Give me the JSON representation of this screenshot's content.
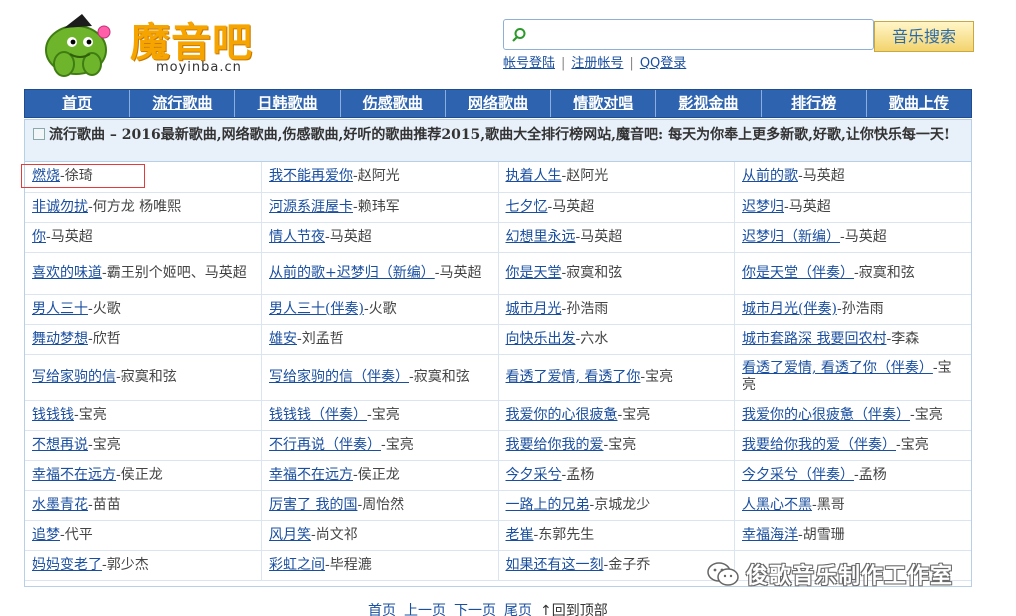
{
  "header": {
    "logo_text": "魔音吧",
    "logo_domain": "moyinba.cn",
    "search_button": "音乐搜索",
    "search_value": "",
    "account": {
      "login": "帐号登陆",
      "register": "注册帐号",
      "qq": "QQ登录"
    }
  },
  "nav": [
    "首页",
    "流行歌曲",
    "日韩歌曲",
    "伤感歌曲",
    "网络歌曲",
    "情歌对唱",
    "影视金曲",
    "排行榜",
    "歌曲上传"
  ],
  "intro": {
    "title": "流行歌曲",
    "text": " – 2016最新歌曲,网络歌曲,伤感歌曲,好听的歌曲推荐2015,歌曲大全排行榜网站,魔音吧: 每天为你奉上更多新歌,好歌,让你快乐每一天!"
  },
  "rows": [
    [
      {
        "song": "燃烧",
        "artist": "徐琦"
      },
      {
        "song": "我不能再爱你",
        "artist": "赵阿光"
      },
      {
        "song": "执着人生",
        "artist": "赵阿光"
      },
      {
        "song": "从前的歌",
        "artist": "马英超"
      }
    ],
    [
      {
        "song": "非诚勿扰",
        "artist": "何方龙 杨唯熙"
      },
      {
        "song": "河源系涯屋卡",
        "artist": "赖玮军"
      },
      {
        "song": "七夕忆",
        "artist": "马英超"
      },
      {
        "song": "迟梦归",
        "artist": "马英超"
      }
    ],
    [
      {
        "song": "你",
        "artist": "马英超"
      },
      {
        "song": "情人节夜",
        "artist": "马英超"
      },
      {
        "song": "幻想里永远",
        "artist": "马英超"
      },
      {
        "song": "迟梦归（新编）",
        "artist": "马英超"
      }
    ],
    [
      {
        "song": "喜欢的味道",
        "artist": "霸王别个姬吧、马英超"
      },
      {
        "song": "从前的歌+迟梦归（新编）",
        "artist": "马英超"
      },
      {
        "song": "你是天堂",
        "artist": "寂寞和弦"
      },
      {
        "song": "你是天堂（伴奏）",
        "artist": "寂寞和弦"
      }
    ],
    [
      {
        "song": "男人三十",
        "artist": "火歌"
      },
      {
        "song": "男人三十(伴奏)",
        "artist": "火歌"
      },
      {
        "song": "城市月光",
        "artist": "孙浩雨"
      },
      {
        "song": "城市月光(伴奏)",
        "artist": "孙浩雨"
      }
    ],
    [
      {
        "song": "舞动梦想",
        "artist": "欣哲"
      },
      {
        "song": "雄安",
        "artist": "刘孟哲"
      },
      {
        "song": "向快乐出发",
        "artist": "六水"
      },
      {
        "song": "城市套路深 我要回农村",
        "artist": "李森"
      }
    ],
    [
      {
        "song": "写给家驹的信",
        "artist": "寂寞和弦"
      },
      {
        "song": "写给家驹的信（伴奏）",
        "artist": "寂寞和弦"
      },
      {
        "song": "看透了爱情, 看透了你",
        "artist": "宝亮"
      },
      {
        "song": "看透了爱情, 看透了你（伴奏）",
        "artist": "宝亮"
      }
    ],
    [
      {
        "song": "钱钱钱",
        "artist": "宝亮"
      },
      {
        "song": "钱钱钱（伴奏）",
        "artist": "宝亮"
      },
      {
        "song": "我爱你的心很疲惫",
        "artist": "宝亮"
      },
      {
        "song": "我爱你的心很疲惫（伴奏）",
        "artist": "宝亮"
      }
    ],
    [
      {
        "song": "不想再说",
        "artist": "宝亮"
      },
      {
        "song": "不行再说（伴奏）",
        "artist": "宝亮"
      },
      {
        "song": "我要给你我的爱",
        "artist": "宝亮"
      },
      {
        "song": "我要给你我的爱（伴奏）",
        "artist": "宝亮"
      }
    ],
    [
      {
        "song": "幸福不在远方",
        "artist": "侯正龙"
      },
      {
        "song": "幸福不在远方",
        "artist": "侯正龙"
      },
      {
        "song": "今夕采兮",
        "artist": "孟杨"
      },
      {
        "song": "今夕采兮（伴奏）",
        "artist": "孟杨"
      }
    ],
    [
      {
        "song": "水墨青花",
        "artist": "苗苗"
      },
      {
        "song": "厉害了 我的国",
        "artist": "周怡然"
      },
      {
        "song": "一路上的兄弟",
        "artist": "京城龙少"
      },
      {
        "song": "人黑心不黑",
        "artist": "黑哥"
      }
    ],
    [
      {
        "song": "追梦",
        "artist": "代平"
      },
      {
        "song": "风月笑",
        "artist": "尚文祁"
      },
      {
        "song": "老崔",
        "artist": "东郭先生"
      },
      {
        "song": "幸福海洋",
        "artist": "胡雪珊"
      }
    ],
    [
      {
        "song": "妈妈变老了",
        "artist": "郭少杰"
      },
      {
        "song": "彩虹之间",
        "artist": "毕程漉"
      },
      {
        "song": "如果还有这一刻",
        "artist": "金子乔"
      },
      {
        "song": "",
        "artist": ""
      }
    ]
  ],
  "pager": {
    "first": "首页",
    "prev": "上一页",
    "next": "下一页",
    "last": "尾页",
    "top": "↑回到顶部"
  },
  "watermark": "俊歌音乐制作工作室"
}
